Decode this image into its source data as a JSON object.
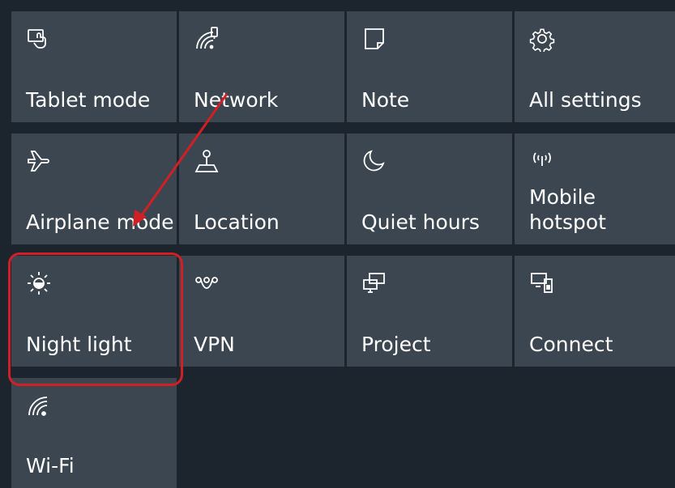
{
  "tiles": [
    {
      "label": "Tablet mode",
      "icon": "tablet-mode-icon"
    },
    {
      "label": "Network",
      "icon": "network-icon"
    },
    {
      "label": "Note",
      "icon": "note-icon"
    },
    {
      "label": "All settings",
      "icon": "gear-icon"
    },
    {
      "label": "Airplane mode",
      "icon": "airplane-icon"
    },
    {
      "label": "Location",
      "icon": "location-icon"
    },
    {
      "label": "Quiet hours",
      "icon": "moon-icon"
    },
    {
      "label": "Mobile\nhotspot",
      "icon": "hotspot-icon"
    },
    {
      "label": "Night light",
      "icon": "sun-icon"
    },
    {
      "label": "VPN",
      "icon": "vpn-icon"
    },
    {
      "label": "Project",
      "icon": "project-icon"
    },
    {
      "label": "Connect",
      "icon": "connect-icon"
    },
    {
      "label": "Wi-Fi",
      "icon": "wifi-icon"
    }
  ],
  "colors": {
    "tile_bg": "#3b4650",
    "panel_bg": "#1c252d",
    "annotation": "#d21f25"
  }
}
